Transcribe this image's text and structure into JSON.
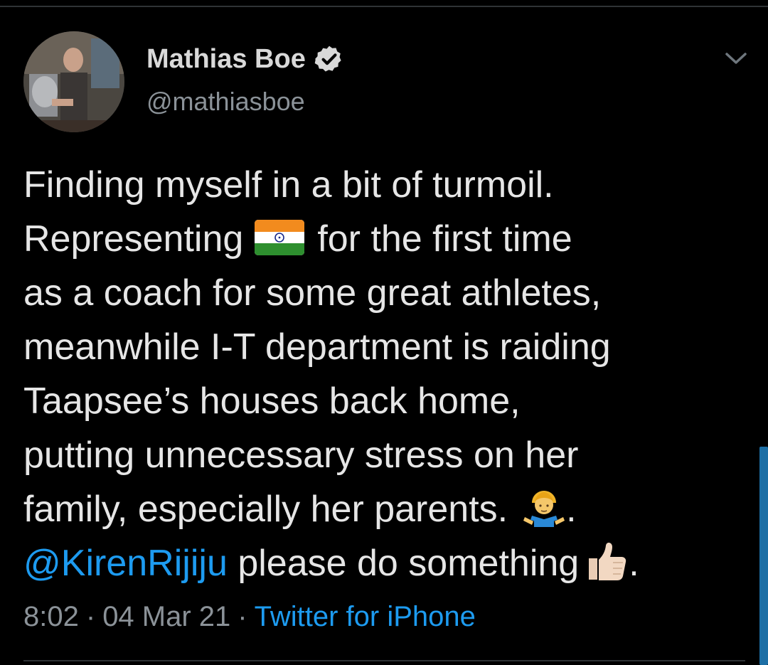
{
  "author": {
    "display_name": "Mathias Boe",
    "handle": "@mathiasboe",
    "verified_icon": "verified-badge-icon"
  },
  "tweet": {
    "lines": {
      "l1": "Finding myself in a bit of turmoil.",
      "l2_before": "Representing",
      "l2_after": "for the first time",
      "l3": "as a coach for some great athletes,",
      "l4": "meanwhile I-T department is raiding",
      "l5": "Taapsee’s houses back home,",
      "l6": "putting unnecessary stress on her",
      "l7_before": "family, especially her parents.",
      "l7_after": ".",
      "l8_mention": "@KirenRijiju",
      "l8_text": " please do something",
      "l8_after": "."
    },
    "emojis": {
      "flag": "india-flag-icon",
      "shrug": "man-shrugging-icon",
      "thumbs": "thumbs-up-icon"
    }
  },
  "meta": {
    "time": "8:02",
    "date": "04 Mar 21",
    "dot": "·",
    "source": "Twitter for iPhone"
  },
  "colors": {
    "background": "#000000",
    "accent": "#1d9bf0",
    "secondary_text": "#8b9298"
  }
}
